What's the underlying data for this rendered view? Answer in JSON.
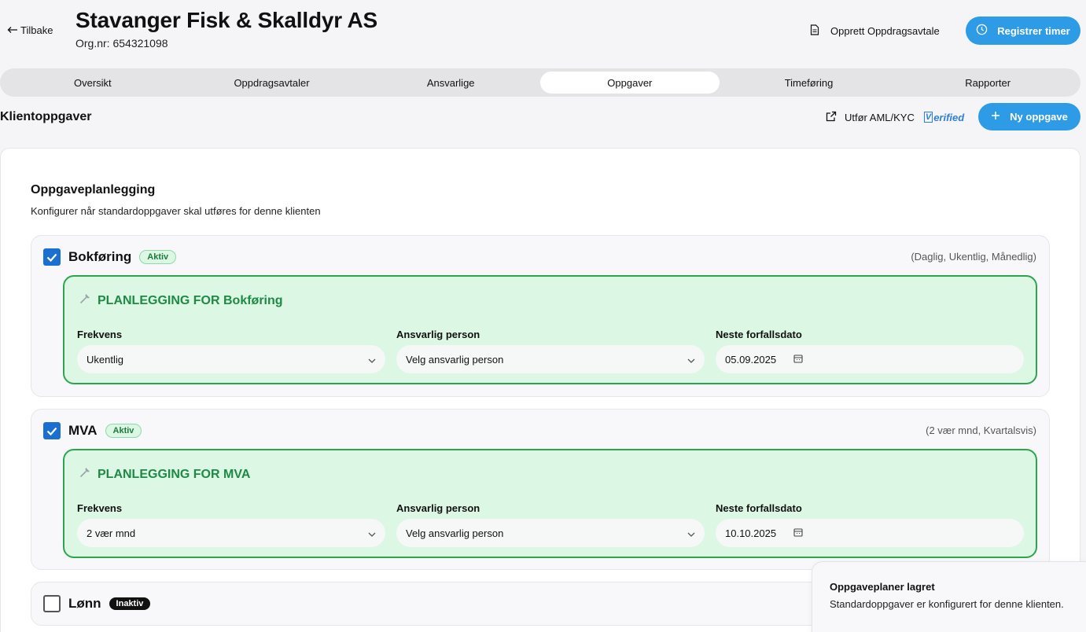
{
  "header": {
    "back_label": "Tilbake",
    "title": "Stavanger Fisk & Skalldyr AS",
    "orgnr": "Org.nr: 654321098",
    "agreement_label": "Opprett Oppdragsavtale",
    "register_label": "Registrer timer"
  },
  "tabs": [
    {
      "label": "Oversikt",
      "active": false
    },
    {
      "label": "Oppdragsavtaler",
      "active": false
    },
    {
      "label": "Ansvarlige",
      "active": false
    },
    {
      "label": "Oppgaver",
      "active": true
    },
    {
      "label": "Timeføring",
      "active": false
    },
    {
      "label": "Rapporter",
      "active": false
    }
  ],
  "section": {
    "title": "Klientoppgaver",
    "aml_label": "Utfør AML/KYC",
    "verified_logo": "erified",
    "new_task_label": "Ny oppgave"
  },
  "card": {
    "title": "Oppgaveplanlegging",
    "subtitle": "Konfigurer når standardoppgaver skal utføres for denne klienten"
  },
  "field_labels": {
    "frequency": "Frekvens",
    "responsible": "Ansvarlig person",
    "due_date": "Neste forfallsdato"
  },
  "tasks": [
    {
      "name": "Bokføring",
      "checked": true,
      "badge": "Aktiv",
      "frequencies": "(Daglig, Ukentlig, Månedlig)",
      "plan_title": "PLANLEGGING FOR Bokføring",
      "frequency": "Ukentlig",
      "responsible": "Velg ansvarlig person",
      "due_date": "05.09.2025"
    },
    {
      "name": "MVA",
      "checked": true,
      "badge": "Aktiv",
      "frequencies": "(2 vær mnd, Kvartalsvis)",
      "plan_title": "PLANLEGGING FOR MVA",
      "frequency": "2 vær mnd",
      "responsible": "Velg ansvarlig person",
      "due_date": "10.10.2025"
    },
    {
      "name": "Lønn",
      "checked": false,
      "badge": "Inaktiv"
    }
  ],
  "toast": {
    "title": "Oppgaveplaner lagret",
    "body": "Standardoppgaver er konfigurert for denne klienten."
  },
  "colors": {
    "primary": "#2e9be6",
    "plan_bg": "#dcf7e3",
    "plan_border": "#2ea44f",
    "checkbox": "#1b6fd1"
  }
}
